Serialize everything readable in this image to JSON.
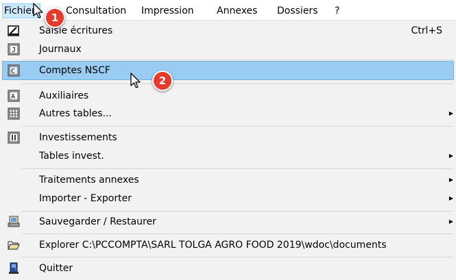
{
  "menubar": {
    "items": [
      {
        "label": "Fichier"
      },
      {
        "label": "Consultation"
      },
      {
        "label": "Impression"
      },
      {
        "label": "Annexes"
      },
      {
        "label": "Dossiers"
      },
      {
        "label": "?"
      }
    ]
  },
  "menu": {
    "items": [
      {
        "label": "Saisie écritures",
        "shortcut": "Ctrl+S",
        "icon": "pencil-icon"
      },
      {
        "label": "Journaux",
        "icon": "journal-icon"
      },
      {
        "label": "Comptes NSCF",
        "icon": "accounts-icon",
        "highlighted": true
      },
      {
        "label": "Auxiliaires",
        "icon": "auxiliary-icon"
      },
      {
        "label": "Autres tables...",
        "icon": "table-icon",
        "submenu": true
      },
      {
        "label": "Investissements",
        "icon": "investment-icon"
      },
      {
        "label": "Tables invest.",
        "submenu": true
      },
      {
        "label": "Traitements annexes",
        "submenu": true
      },
      {
        "label": "Importer - Exporter",
        "submenu": true
      },
      {
        "label": "Sauvegarder / Restaurer",
        "icon": "backup-icon",
        "submenu": true
      },
      {
        "label": "Explorer C:\\PCCOMPTA\\SARL TOLGA AGRO FOOD 2019\\wdoc\\documents",
        "icon": "folder-open-icon"
      },
      {
        "label": "Quitter",
        "icon": "exit-icon"
      }
    ]
  },
  "annotations": {
    "badge1": "1",
    "badge2": "2",
    "color": "#e53b2c"
  },
  "colors": {
    "highlight": "#99ccf2",
    "menu_bg": "#f2f2f2",
    "active_menubar": "#cce8ff"
  }
}
